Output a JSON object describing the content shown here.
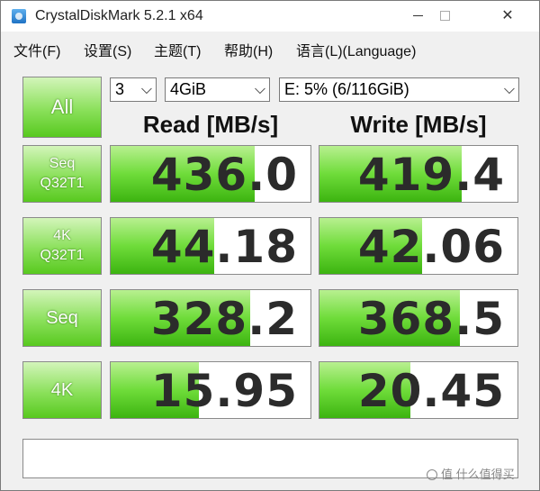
{
  "window": {
    "title": "CrystalDiskMark 5.2.1 x64",
    "minimize": "—",
    "maximize": "☐",
    "close": "✕"
  },
  "menu": [
    {
      "label": "文件(F)"
    },
    {
      "label": "设置(S)"
    },
    {
      "label": "主题(T)"
    },
    {
      "label": "帮助(H)"
    },
    {
      "label": "语言(L)(Language)"
    }
  ],
  "controls": {
    "all_label": "All",
    "test_count": "3",
    "test_size": "4GiB",
    "drive": "E: 5% (6/116GiB)"
  },
  "headers": {
    "read": "Read [MB/s]",
    "write": "Write [MB/s]"
  },
  "rows": [
    {
      "line1": "Seq",
      "line2": "Q32T1",
      "read": "436.0",
      "write": "419.4",
      "read_fill": 0.72,
      "write_fill": 0.72
    },
    {
      "line1": "4K",
      "line2": "Q32T1",
      "read": "44.18",
      "write": "42.06",
      "read_fill": 0.52,
      "write_fill": 0.52
    },
    {
      "line1": "Seq",
      "line2": "",
      "read": "328.2",
      "write": "368.5",
      "read_fill": 0.7,
      "write_fill": 0.71
    },
    {
      "line1": "4K",
      "line2": "",
      "read": "15.95",
      "write": "20.45",
      "read_fill": 0.44,
      "write_fill": 0.46
    }
  ],
  "comment": "",
  "watermark": "值 什么值得买",
  "colors": {
    "accent_green": "#58c91f",
    "bar_green": "#6fdc3a"
  }
}
